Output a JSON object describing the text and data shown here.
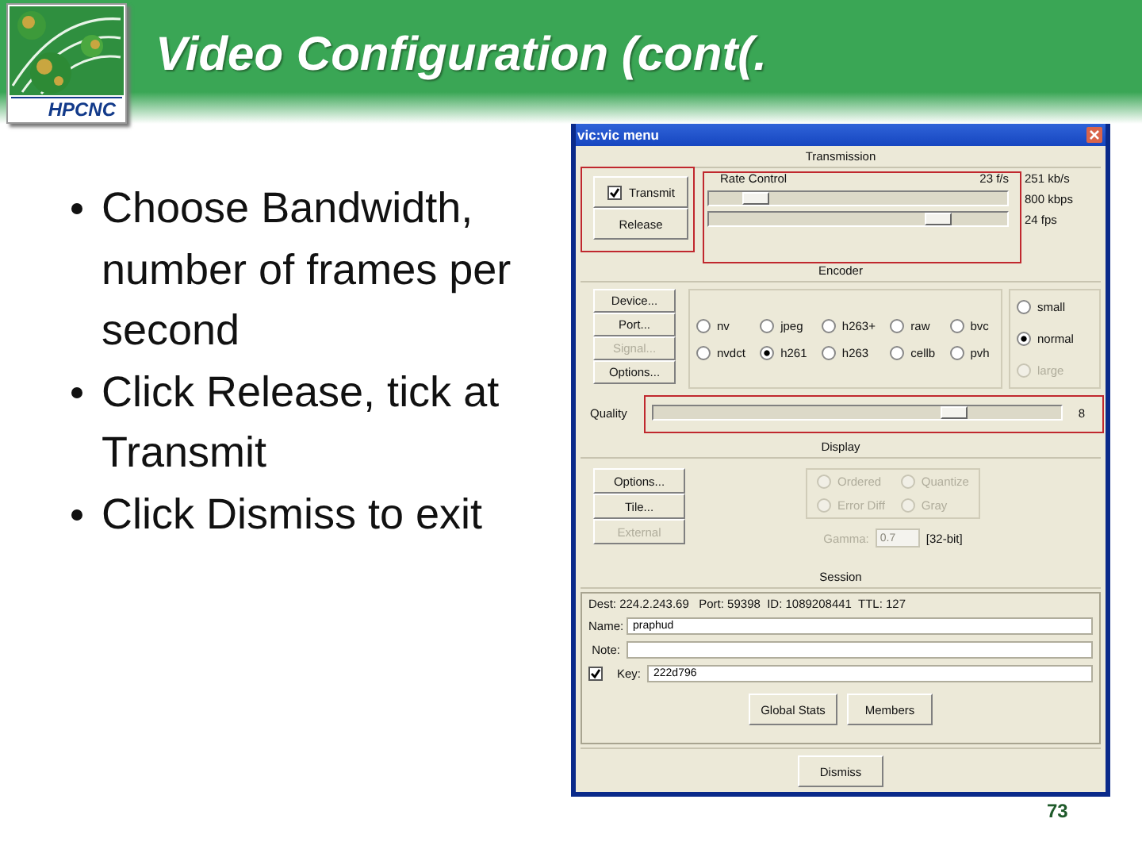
{
  "slide": {
    "title": "Video Configuration (cont(.",
    "logo_text": "HPCNC",
    "bullets": [
      "Choose Bandwidth, number of frames per second",
      "Click Release, tick at Transmit",
      "Click Dismiss to exit"
    ],
    "page_number": "73"
  },
  "window": {
    "title": "vic:vic menu",
    "transmission": {
      "heading": "Transmission",
      "transmit": {
        "label": "Transmit",
        "checked": true
      },
      "release": "Release",
      "rate_control": {
        "label": "Rate Control",
        "frame_rate": "23 f/s",
        "bit_rate": "251 kb/s"
      },
      "sliders": [
        {
          "level": 0.16,
          "reading": "800 kbps"
        },
        {
          "level": 0.77,
          "reading": "24 fps"
        }
      ]
    },
    "encoder": {
      "heading": "Encoder",
      "buttons": [
        {
          "label": "Device...",
          "disabled": false
        },
        {
          "label": "Port...",
          "disabled": false
        },
        {
          "label": "Signal...",
          "disabled": true
        },
        {
          "label": "Options...",
          "disabled": false
        }
      ],
      "formats": [
        {
          "label": "nv",
          "selected": false
        },
        {
          "label": "jpeg",
          "selected": false
        },
        {
          "label": "h263+",
          "selected": false
        },
        {
          "label": "raw",
          "selected": false
        },
        {
          "label": "bvc",
          "selected": false
        },
        {
          "label": "nvdct",
          "selected": false
        },
        {
          "label": "h261",
          "selected": true
        },
        {
          "label": "h263",
          "selected": false
        },
        {
          "label": "cellb",
          "selected": false
        },
        {
          "label": "pvh",
          "selected": false
        }
      ],
      "sizes": [
        {
          "label": "small",
          "selected": false,
          "disabled": false
        },
        {
          "label": "normal",
          "selected": true,
          "disabled": false
        },
        {
          "label": "large",
          "selected": false,
          "disabled": true
        }
      ],
      "quality": {
        "label": "Quality",
        "level": 0.74,
        "reading": "8"
      }
    },
    "display": {
      "heading": "Display",
      "buttons": [
        {
          "label": "Options...",
          "disabled": false
        },
        {
          "label": "Tile...",
          "disabled": false
        },
        {
          "label": "External",
          "disabled": true
        }
      ],
      "dither": [
        {
          "label": "Ordered",
          "selected": false,
          "disabled": true
        },
        {
          "label": "Quantize",
          "selected": false,
          "disabled": true
        },
        {
          "label": "Error Diff",
          "selected": false,
          "disabled": true
        },
        {
          "label": "Gray",
          "selected": false,
          "disabled": true
        }
      ],
      "gamma": {
        "label": "Gamma:",
        "value": "0.7",
        "disabled": true
      },
      "depth": "[32-bit]"
    },
    "session": {
      "heading": "Session",
      "info": "Dest: 224.2.243.69   Port: 59398  ID: 1089208441  TTL: 127",
      "fields": [
        {
          "label": "Name:",
          "value": "praphud"
        },
        {
          "label": "Note:"
        },
        {
          "label": "Key:",
          "value": "222d796",
          "checked": true
        }
      ],
      "buttons": [
        "Global Stats",
        "Members"
      ]
    },
    "dismiss": "Dismiss"
  }
}
